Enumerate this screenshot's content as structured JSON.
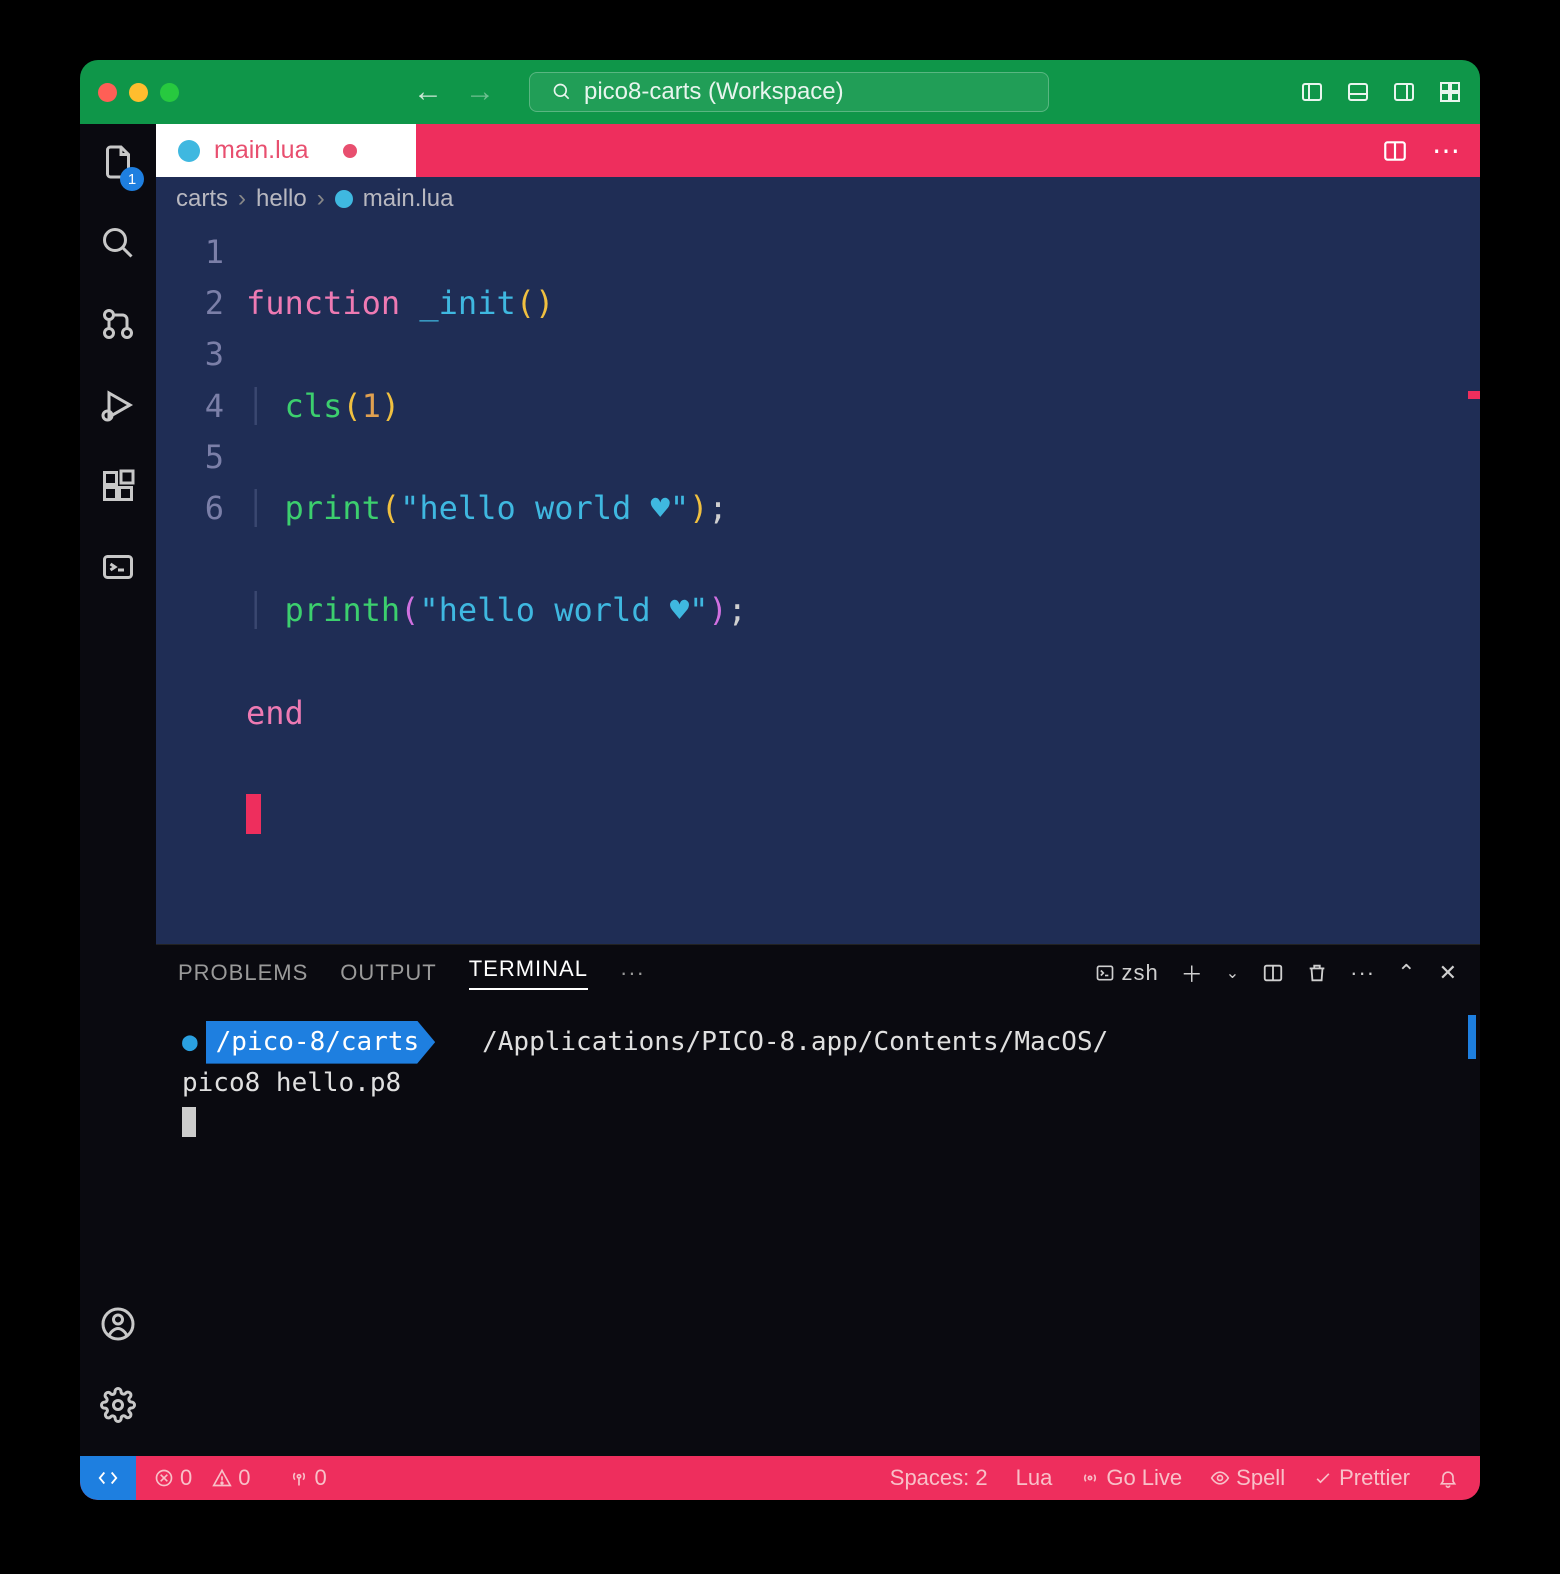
{
  "titlebar": {
    "search_label": "pico8-carts (Workspace)"
  },
  "activitybar": {
    "explorer_badge": "1"
  },
  "tabs": {
    "file": "main.lua"
  },
  "tab_actions": {
    "more_glyph": "⋯"
  },
  "breadcrumb": {
    "seg1": "carts",
    "seg2": "hello",
    "seg3": "main.lua"
  },
  "editor": {
    "line_numbers": [
      "1",
      "2",
      "3",
      "4",
      "5",
      "6"
    ],
    "l1": {
      "kw": "function",
      "name": "_init",
      "op": "(",
      "cp": ")"
    },
    "l2": {
      "fn": "cls",
      "op": "(",
      "arg": "1",
      "cp": ")"
    },
    "l3": {
      "fn": "print",
      "op": "(",
      "str": "\"hello world ♥\"",
      "cp": ")",
      "semi": ";"
    },
    "l4": {
      "fn": "printh",
      "op": "(",
      "str": "\"hello world ♥\"",
      "cp": ")",
      "semi": ";"
    },
    "l5": {
      "kw": "end"
    }
  },
  "panel": {
    "tabs": {
      "problems": "PROBLEMS",
      "output": "OUTPUT",
      "terminal": "TERMINAL",
      "more": "···"
    },
    "shell_label": "zsh",
    "prompt_path": "/pico-8/carts",
    "cmd_part1": "/Applications/PICO-8.app/Contents/MacOS/",
    "cmd_part2": "pico8 hello.p8"
  },
  "statusbar": {
    "errors": "0",
    "warnings": "0",
    "ports": "0",
    "spaces": "Spaces: 2",
    "lang": "Lua",
    "golive": "Go Live",
    "spell": "Spell",
    "prettier": "Prettier"
  }
}
